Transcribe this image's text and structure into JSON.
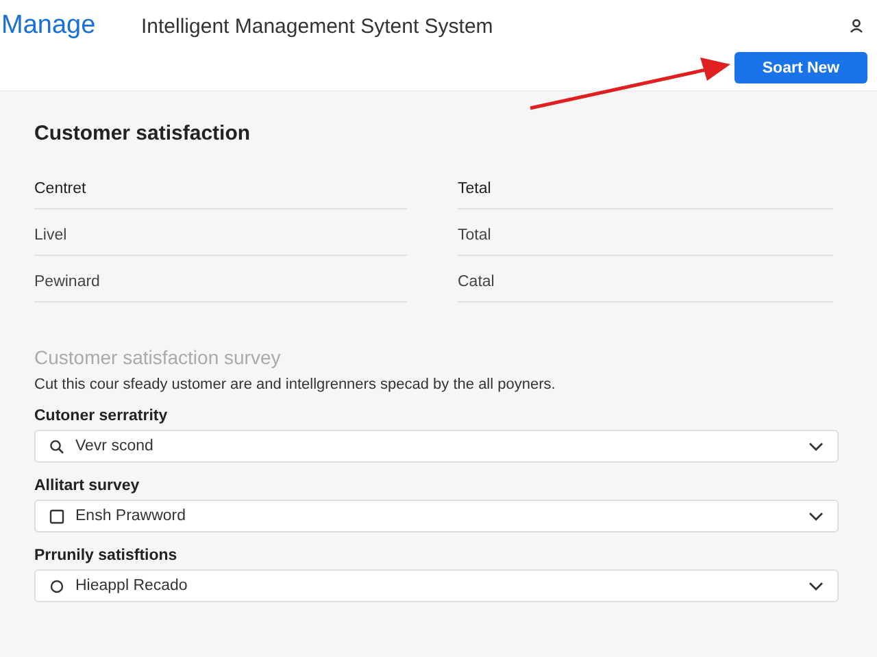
{
  "header": {
    "logo": "Manage",
    "title": "Intelligent Management Sytent System"
  },
  "toolbar": {
    "button": "Soart New"
  },
  "summary": {
    "title": "Customer satisfaction",
    "rows": [
      {
        "left": "Centret",
        "right": "Tetal"
      },
      {
        "left": "Livel",
        "right": "Total"
      },
      {
        "left": "Pewinard",
        "right": "Catal"
      }
    ]
  },
  "survey": {
    "title": "Customer satisfaction survey",
    "description": "Cut this cour sfeady ustomer are and intellgrenners specad by the all poyners.",
    "fields": [
      {
        "label": "Cutoner serratrity",
        "kind": "search",
        "value": "Vevr scond"
      },
      {
        "label": "Allitart survey",
        "kind": "checkbox",
        "value": "Ensh Prawword"
      },
      {
        "label": "Prrunily satisftions",
        "kind": "radio",
        "value": "Hieappl Recado"
      }
    ]
  }
}
